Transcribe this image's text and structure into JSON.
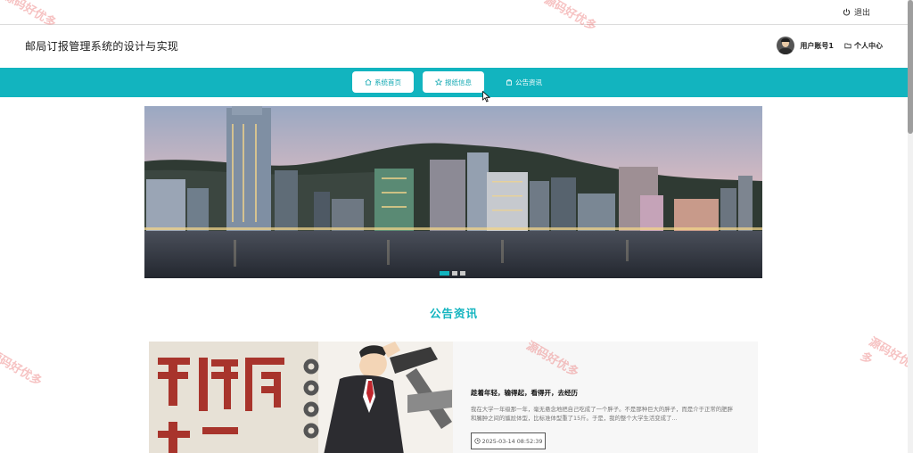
{
  "topbar": {
    "logout_label": "退出"
  },
  "header": {
    "site_title": "邮局订报管理系统的设计与实现",
    "username": "用户账号1",
    "profile_label": "个人中心"
  },
  "nav": {
    "items": [
      {
        "label": "系统首页",
        "icon": "home-icon"
      },
      {
        "label": "报纸信息",
        "icon": "star-icon"
      },
      {
        "label": "公告资讯",
        "icon": "bag-icon"
      }
    ]
  },
  "carousel": {
    "slide_count": 3,
    "active_index": 0
  },
  "announcements": {
    "section_title": "公告资讯",
    "items": [
      {
        "headline": "趁着年轻，输得起，看得开，去经历",
        "excerpt": "我在大学一年级那一年，毫无悬念地把自己吃成了一个胖子。不是那种巨大的胖子，而是介于正常的肥胖和臃肿之间的尴尬体型，比标准体型重了15斤。于是，我的整个大学生活变成了...",
        "date": "2025-03-14 08:52:39"
      }
    ]
  },
  "watermark_text": "源码好优多",
  "colors": {
    "accent": "#12b4bf"
  }
}
